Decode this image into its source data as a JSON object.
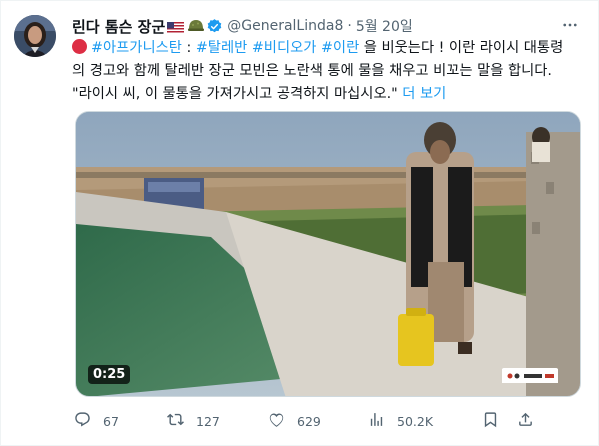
{
  "user": {
    "display_name": "린다 톰슨 장군",
    "handle": "@GeneralLinda8",
    "separator": "·",
    "date": "5월 20일"
  },
  "tweet": {
    "tag1": "#아프가니스탄",
    "colon": " : ",
    "tag2": "#탈레반",
    "tag3": "#비디오가",
    "tag4": "#이란",
    "text_after_tags": " 을 비웃는다 ! 이란 라이시 대통령의 경고와 함께 탈레반 장군 모빈은 노란색 통에 물을 채우고 비꼬는 말을 합니다. \"라이시 씨, 이 물통을 가져가시고 공격하지 마십시오.\" ",
    "show_more": "더 보기"
  },
  "media": {
    "duration": "0:25"
  },
  "actions": {
    "replies": "67",
    "retweets": "127",
    "likes": "629",
    "views": "50.2K"
  },
  "colors": {
    "accent": "#1d9bf0",
    "muted": "#536471",
    "text": "#0f1419"
  },
  "icons": [
    "flag-us-icon",
    "helmet-icon",
    "verified-badge-icon",
    "more-icon",
    "red-circle-icon",
    "reply-icon",
    "retweet-icon",
    "like-icon",
    "views-icon",
    "bookmark-icon",
    "share-icon"
  ]
}
